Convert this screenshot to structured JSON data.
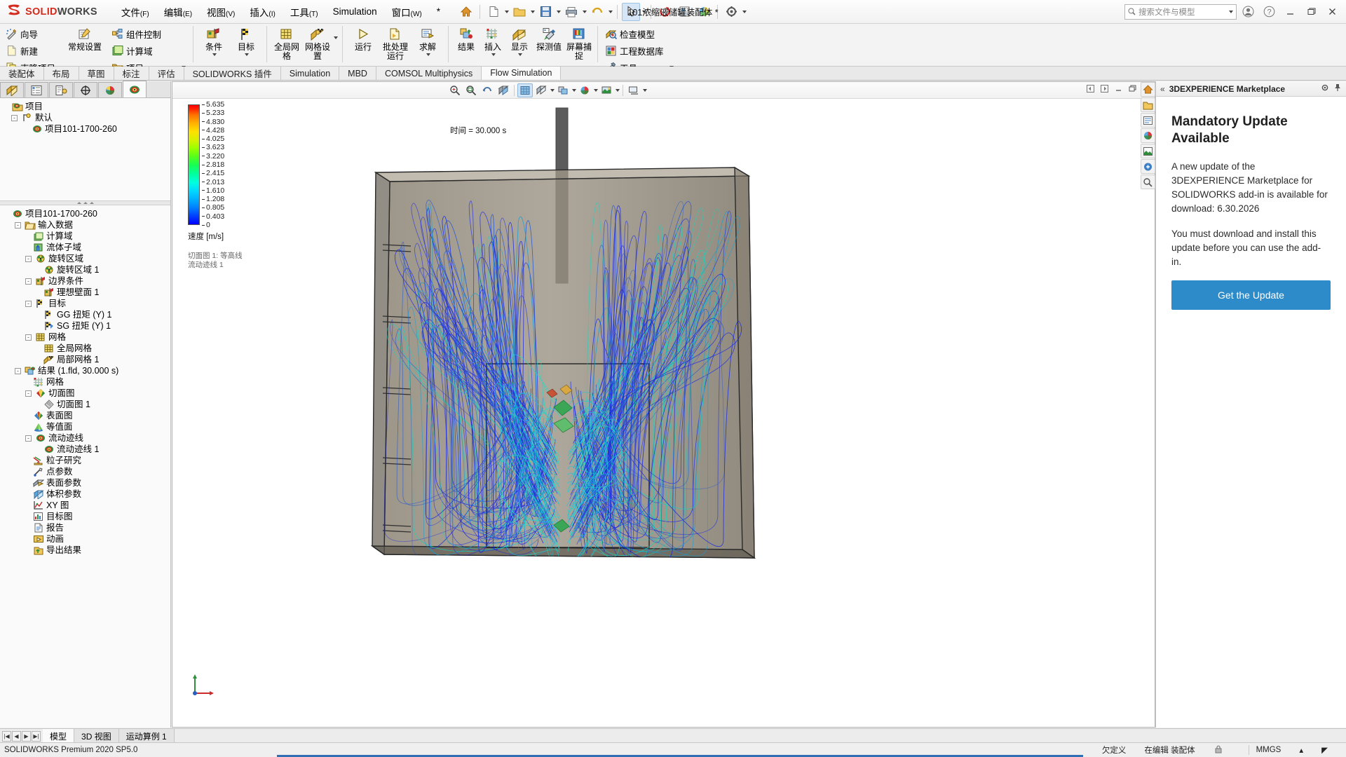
{
  "titlebar": {
    "brand_mark": "DS",
    "brand_bold": "SOLID",
    "brand_light": "WORKS",
    "menus": [
      {
        "label": "文件",
        "mnemonic": "(F)"
      },
      {
        "label": "编辑",
        "mnemonic": "(E)"
      },
      {
        "label": "视图",
        "mnemonic": "(V)"
      },
      {
        "label": "插入",
        "mnemonic": "(I)"
      },
      {
        "label": "工具",
        "mnemonic": "(T)"
      },
      {
        "label": "Simulation",
        "mnemonic": ""
      },
      {
        "label": "窗口",
        "mnemonic": "(W)"
      },
      {
        "label": "*",
        "mnemonic": ""
      }
    ],
    "document_title": "101浓缩液储罐装配体 *",
    "search_placeholder": "搜索文件与模型",
    "quick_access": [
      "home-icon",
      "new-document-icon",
      "open-folder-icon",
      "save-icon",
      "print-icon",
      "undo-icon",
      "select-icon",
      "rebuild-icon",
      "drawing-icon",
      "appearance-icon",
      "options-icon"
    ],
    "window_buttons": [
      "user-icon",
      "help-icon",
      "minimize-icon",
      "restore-icon",
      "close-icon"
    ]
  },
  "ribbon": {
    "groups": [
      {
        "name": "project",
        "small_items": [
          {
            "label": "向导",
            "icon": "wizard-icon"
          },
          {
            "label": "新建",
            "icon": "new-icon"
          },
          {
            "label": "克隆项目",
            "icon": "clone-icon"
          }
        ],
        "big_items": [
          {
            "label": "常规设置",
            "icon": "general-settings-icon"
          }
        ],
        "small_items2": [
          {
            "label": "组件控制",
            "icon": "component-control-icon"
          },
          {
            "label": "计算域",
            "icon": "computational-domain-icon"
          },
          {
            "label": "项目",
            "icon": "project-folder-icon"
          }
        ]
      },
      {
        "name": "definition",
        "big_items": [
          {
            "label": "条件",
            "icon": "conditions-icon",
            "dropdown": true
          },
          {
            "label": "目标",
            "icon": "goals-icon",
            "dropdown": true
          }
        ]
      },
      {
        "name": "mesh",
        "big_items": [
          {
            "label": "全局网格",
            "icon": "global-mesh-icon"
          },
          {
            "label": "网格设置",
            "icon": "mesh-settings-icon",
            "dropdown": true
          }
        ]
      },
      {
        "name": "solve",
        "big_items": [
          {
            "label": "运行",
            "icon": "run-icon"
          },
          {
            "label": "批处理运行",
            "icon": "batch-run-icon"
          },
          {
            "label": "求解",
            "icon": "solve-icon",
            "dropdown": true
          }
        ]
      },
      {
        "name": "results",
        "big_items": [
          {
            "label": "结果",
            "icon": "results-icon"
          },
          {
            "label": "插入",
            "icon": "insert-icon",
            "dropdown": true
          },
          {
            "label": "显示",
            "icon": "display-icon",
            "dropdown": true
          },
          {
            "label": "探测值",
            "icon": "probe-icon"
          },
          {
            "label": "屏幕捕捉",
            "icon": "screen-capture-icon"
          }
        ]
      },
      {
        "name": "tools",
        "small_items": [
          {
            "label": "检查模型",
            "icon": "check-model-icon"
          },
          {
            "label": "工程数据库",
            "icon": "engineering-database-icon"
          },
          {
            "label": "工具",
            "icon": "tools-icon",
            "dropdown": true
          }
        ]
      }
    ]
  },
  "command_tabs": {
    "items": [
      "装配体",
      "布局",
      "草图",
      "标注",
      "评估",
      "SOLIDWORKS 插件",
      "Simulation",
      "MBD",
      "COMSOL Multiphysics",
      "Flow Simulation"
    ],
    "active": "Flow Simulation"
  },
  "left_panel": {
    "tree_tabs": [
      {
        "name": "feature-manager-tab",
        "icon": "feature-tree-icon"
      },
      {
        "name": "property-manager-tab",
        "icon": "property-list-icon"
      },
      {
        "name": "configuration-manager-tab",
        "icon": "configuration-icon"
      },
      {
        "name": "dimxpert-tab",
        "icon": "dimxpert-icon"
      },
      {
        "name": "display-manager-tab",
        "icon": "render-sphere-icon"
      },
      {
        "name": "flow-simulation-tab",
        "icon": "flow-simulation-icon"
      }
    ],
    "active_tree_tab": 5,
    "config_tree": [
      {
        "label": "项目",
        "depth": 0,
        "icon": "project-root-icon",
        "expander": ""
      },
      {
        "label": "默认",
        "depth": 1,
        "icon": "configuration-icon",
        "expander": "-"
      },
      {
        "label": "项目101-1700-260",
        "depth": 2,
        "icon": "flow-project-icon",
        "expander": ""
      }
    ],
    "analysis_tree": [
      {
        "label": "项目101-1700-260",
        "depth": 0,
        "icon": "flow-project-icon",
        "expander": ""
      },
      {
        "label": "输入数据",
        "depth": 1,
        "icon": "input-data-icon",
        "expander": "-"
      },
      {
        "label": "计算域",
        "depth": 2,
        "icon": "computational-domain-icon",
        "expander": ""
      },
      {
        "label": "流体子域",
        "depth": 2,
        "icon": "fluid-subdomain-icon",
        "expander": ""
      },
      {
        "label": "旋转区域",
        "depth": 2,
        "icon": "rotating-region-icon",
        "expander": "-"
      },
      {
        "label": "旋转区域 1",
        "depth": 3,
        "icon": "rotating-region-icon",
        "expander": ""
      },
      {
        "label": "边界条件",
        "depth": 2,
        "icon": "boundary-condition-icon",
        "expander": "-"
      },
      {
        "label": "理想壁面 1",
        "depth": 3,
        "icon": "boundary-condition-icon",
        "expander": ""
      },
      {
        "label": "目标",
        "depth": 2,
        "icon": "goal-flag-icon",
        "expander": "-"
      },
      {
        "label": "GG 扭矩 (Y) 1",
        "depth": 3,
        "icon": "goal-flag-icon",
        "expander": ""
      },
      {
        "label": "SG 扭矩 (Y) 1",
        "depth": 3,
        "icon": "goal-flag-blue-icon",
        "expander": ""
      },
      {
        "label": "网格",
        "depth": 2,
        "icon": "mesh-icon",
        "expander": "-"
      },
      {
        "label": "全局网格",
        "depth": 3,
        "icon": "mesh-icon",
        "expander": ""
      },
      {
        "label": "局部网格 1",
        "depth": 3,
        "icon": "local-mesh-icon",
        "expander": ""
      },
      {
        "label": "结果 (1.fld, 30.000 s)",
        "depth": 1,
        "icon": "results-icon",
        "expander": "-"
      },
      {
        "label": "网格",
        "depth": 2,
        "icon": "result-mesh-icon",
        "expander": ""
      },
      {
        "label": "切面图",
        "depth": 2,
        "icon": "cut-plot-icon",
        "expander": "-"
      },
      {
        "label": "切面图 1",
        "depth": 3,
        "icon": "cut-plot-gray-icon",
        "expander": ""
      },
      {
        "label": "表面图",
        "depth": 2,
        "icon": "surface-plot-icon",
        "expander": ""
      },
      {
        "label": "等值面",
        "depth": 2,
        "icon": "isosurface-icon",
        "expander": ""
      },
      {
        "label": "流动迹线",
        "depth": 2,
        "icon": "flow-trajectories-icon",
        "expander": "-"
      },
      {
        "label": "流动迹线 1",
        "depth": 3,
        "icon": "flow-trajectories-icon",
        "expander": ""
      },
      {
        "label": "粒子研究",
        "depth": 2,
        "icon": "particle-study-icon",
        "expander": ""
      },
      {
        "label": "点参数",
        "depth": 2,
        "icon": "point-parameters-icon",
        "expander": ""
      },
      {
        "label": "表面参数",
        "depth": 2,
        "icon": "surface-parameters-icon",
        "expander": ""
      },
      {
        "label": "体积参数",
        "depth": 2,
        "icon": "volume-parameters-icon",
        "expander": ""
      },
      {
        "label": "XY 图",
        "depth": 2,
        "icon": "xy-plot-icon",
        "expander": ""
      },
      {
        "label": "目标图",
        "depth": 2,
        "icon": "goal-plot-icon",
        "expander": ""
      },
      {
        "label": "报告",
        "depth": 2,
        "icon": "report-icon",
        "expander": ""
      },
      {
        "label": "动画",
        "depth": 2,
        "icon": "animation-icon",
        "expander": ""
      },
      {
        "label": "导出结果",
        "depth": 2,
        "icon": "export-results-icon",
        "expander": ""
      }
    ]
  },
  "viewport": {
    "toolbar_buttons": [
      "zoom-to-fit-icon",
      "zoom-to-area-icon",
      "previous-view-icon",
      "section-view-icon",
      "view-orientation-icon",
      "display-style-icon",
      "hide-show-icon",
      "edit-appearance-icon",
      "apply-scene-icon",
      "view-settings-icon"
    ],
    "window_controls": [
      "restore-left-icon",
      "restore-right-icon",
      "minimize-icon",
      "restore-icon",
      "close-icon"
    ],
    "time_label": "时间 = 30.000 s",
    "legend": {
      "ticks": [
        "5.635",
        "5.233",
        "4.830",
        "4.428",
        "4.025",
        "3.623",
        "3.220",
        "2.818",
        "2.415",
        "2.013",
        "1.610",
        "1.208",
        "0.805",
        "0.403",
        "0"
      ],
      "title": "速度 [m/s]",
      "caption_lines": [
        "切面图 1: 等高线",
        "流动迹线 1"
      ]
    }
  },
  "right_panel": {
    "header_title": "3DEXPERIENCE Marketplace",
    "header_icons": [
      "collapse-chevron-icon",
      "settings-gear-icon",
      "pin-icon"
    ],
    "title": "Mandatory Update Available",
    "paragraph_1": "A new update of the 3DEXPERIENCE Marketplace for SOLIDWORKS add-in is available for download: 6.30.2026",
    "paragraph_2": "You must download and install this update before you can use the add-in.",
    "cta_label": "Get the Update",
    "rail_icons": [
      "home-icon",
      "folder-icon",
      "library-icon",
      "appearances-icon",
      "scenes-icon",
      "custom-icon",
      "search-icon"
    ],
    "accent_color": "#2e8bc9"
  },
  "doc_tabs": {
    "items": [
      "模型",
      "3D 视图",
      "运动算例 1"
    ],
    "active": "模型"
  },
  "statusbar": {
    "left": "SOLIDWORKS Premium 2020 SP5.0",
    "items": [
      "欠定义",
      "在编辑 装配体",
      "MMGS"
    ],
    "units_caret": "▴"
  }
}
